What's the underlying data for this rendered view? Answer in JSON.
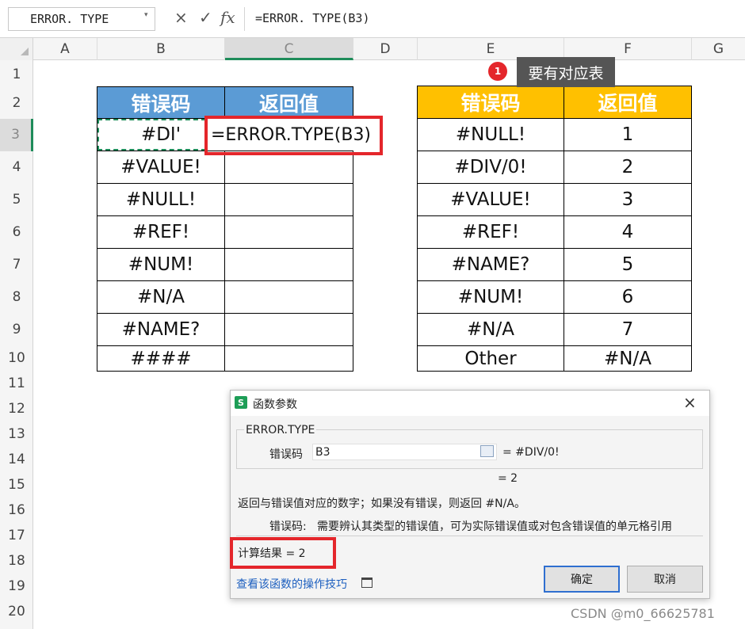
{
  "formula_bar": {
    "name_box": "ERROR. TYPE",
    "cancel_icon": "×",
    "confirm_icon": "✓",
    "fx_icon": "fx",
    "formula": "=ERROR. TYPE(B3)"
  },
  "columns": [
    "A",
    "B",
    "C",
    "D",
    "E",
    "F",
    "G"
  ],
  "rows": [
    "1",
    "2",
    "3",
    "4",
    "5",
    "6",
    "7",
    "8",
    "9",
    "10",
    "11",
    "12",
    "13",
    "14",
    "15",
    "16",
    "17",
    "18",
    "19",
    "20"
  ],
  "left_table": {
    "headers": [
      "错误码",
      "返回值"
    ],
    "codes": [
      "#DI'",
      "#VALUE!",
      "#NULL!",
      "#REF!",
      "#NUM!",
      "#N/A",
      "#NAME?",
      "####"
    ],
    "editing_formula": "=ERROR.TYPE(B3)",
    "header_color": "#5b9bd5"
  },
  "right_table": {
    "headers": [
      "错误码",
      "返回值"
    ],
    "rows": [
      {
        "code": "#NULL!",
        "value": "1"
      },
      {
        "code": "#DIV/0!",
        "value": "2"
      },
      {
        "code": "#VALUE!",
        "value": "3"
      },
      {
        "code": "#REF!",
        "value": "4"
      },
      {
        "code": "#NAME?",
        "value": "5"
      },
      {
        "code": "#NUM!",
        "value": "6"
      },
      {
        "code": "#N/A",
        "value": "7"
      },
      {
        "code": "Other",
        "value": "#N/A"
      }
    ],
    "header_color": "#ffc000"
  },
  "callout": {
    "number": "1",
    "text": "要有对应表"
  },
  "dialog": {
    "title": "函数参数",
    "app_icon": "S",
    "close_icon": "×",
    "function_name": "ERROR.TYPE",
    "arg_label": "错误码",
    "arg_value": "B3",
    "arg_result": "= #DIV/0!",
    "result_line": "= 2",
    "description": "返回与错误值对应的数字；如果没有错误，则返回 #N/A。",
    "arg_desc_label": "错误码:",
    "arg_desc": "需要辨认其类型的错误值，可为实际错误值或对包含错误值的单元格引用",
    "calc_result": "计算结果 = 2",
    "help_link": "查看该函数的操作技巧",
    "ok_label": "确定",
    "cancel_label": "取消"
  },
  "watermark": "CSDN @m0_66625781"
}
